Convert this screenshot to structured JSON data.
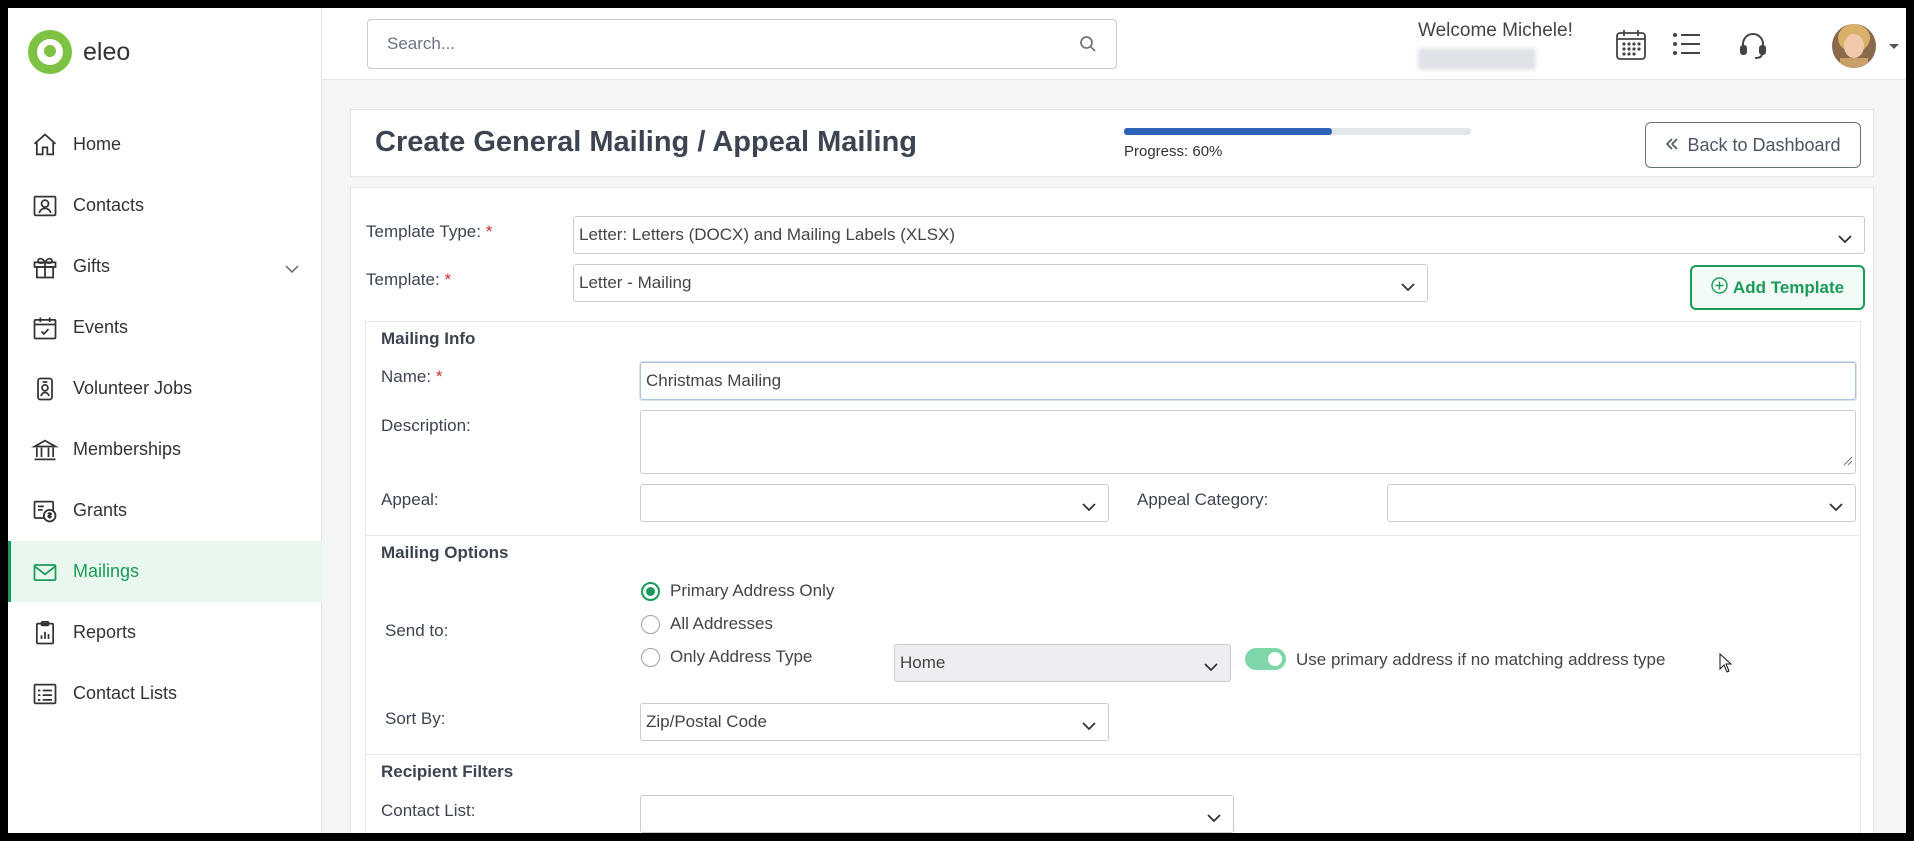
{
  "brand": {
    "name": "eleo",
    "color": "#7dc242"
  },
  "accent": "#1a9b5a",
  "sidebar": {
    "items": [
      {
        "label": "Home",
        "icon": "home-icon"
      },
      {
        "label": "Contacts",
        "icon": "contact-card-icon"
      },
      {
        "label": "Gifts",
        "icon": "gift-icon",
        "expandable": true
      },
      {
        "label": "Events",
        "icon": "calendar-check-icon"
      },
      {
        "label": "Volunteer Jobs",
        "icon": "badge-icon"
      },
      {
        "label": "Memberships",
        "icon": "bank-icon"
      },
      {
        "label": "Grants",
        "icon": "grant-icon"
      },
      {
        "label": "Mailings",
        "icon": "envelope-icon",
        "active": true
      },
      {
        "label": "Reports",
        "icon": "clipboard-chart-icon"
      },
      {
        "label": "Contact Lists",
        "icon": "list-icon"
      }
    ]
  },
  "header": {
    "search_placeholder": "Search...",
    "welcome": "Welcome Michele!"
  },
  "page": {
    "title": "Create General Mailing / Appeal Mailing",
    "progress": {
      "label": "Progress: 60%",
      "value": 60
    },
    "back_label": "Back to Dashboard"
  },
  "form": {
    "template_type": {
      "label": "Template Type:",
      "value": "Letter: Letters (DOCX) and Mailing Labels (XLSX)"
    },
    "template": {
      "label": "Template:",
      "value": "Letter - Mailing"
    },
    "add_template_label": "Add Template",
    "mailing_info": {
      "title": "Mailing Info",
      "name_label": "Name:",
      "name_value": "Christmas Mailing",
      "description_label": "Description:",
      "appeal_label": "Appeal:",
      "appeal_category_label": "Appeal Category:"
    },
    "mailing_options": {
      "title": "Mailing Options",
      "send_to_label": "Send to:",
      "options": [
        "Primary Address Only",
        "All Addresses",
        "Only Address Type"
      ],
      "selected": "Primary Address Only",
      "address_type_value": "Home",
      "toggle_label": "Use primary address if no matching address type",
      "toggle_on": true,
      "sort_by_label": "Sort By:",
      "sort_by_value": "Zip/Postal Code"
    },
    "recipient_filters": {
      "title": "Recipient Filters",
      "contact_list_label": "Contact List:"
    }
  }
}
